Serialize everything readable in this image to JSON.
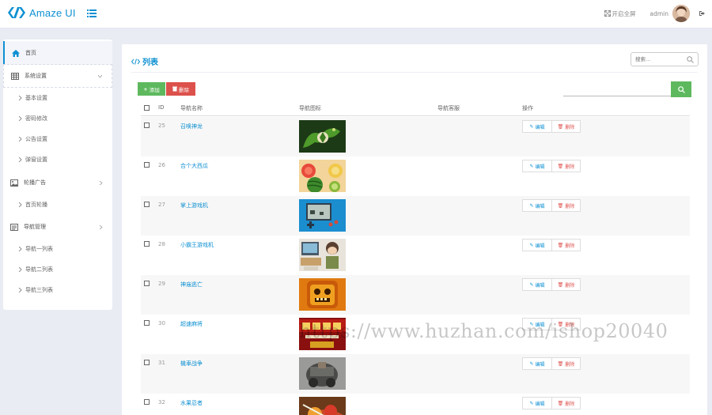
{
  "header": {
    "logo_text": "Amaze UI",
    "fullscreen_label": "开启全屏",
    "admin_name": "admin"
  },
  "sidebar": {
    "home": "首页",
    "groups": [
      {
        "label": "系统设置",
        "items": [
          "基本设置",
          "密码修改",
          "公告设置",
          "弹窗设置"
        ]
      },
      {
        "label": "轮播广告",
        "items": [
          "首页轮播"
        ]
      },
      {
        "label": "导航管理",
        "items": [
          "导航一列表",
          "导航二列表",
          "导航三列表"
        ]
      }
    ]
  },
  "main": {
    "title": "列表",
    "top_search_placeholder": "搜索...",
    "add_label": "添加",
    "delete_label": "删除",
    "columns": {
      "id": "ID",
      "name": "导航名称",
      "icon": "导航图标",
      "service": "导航客服",
      "ops": "操作"
    },
    "edit_label": "编辑",
    "remove_label": "删除",
    "rows": [
      {
        "id": "25",
        "name": "召唤神龙",
        "icon": "dragon-game-thumbnail"
      },
      {
        "id": "26",
        "name": "合个大西瓜",
        "icon": "watermelon-game-thumbnail"
      },
      {
        "id": "27",
        "name": "掌上游戏机",
        "icon": "handheld-console-thumbnail"
      },
      {
        "id": "28",
        "name": "小霸王游戏机",
        "icon": "retro-console-thumbnail"
      },
      {
        "id": "29",
        "name": "神庙逃亡",
        "icon": "temple-run-thumbnail"
      },
      {
        "id": "30",
        "name": "超速麻将",
        "icon": "mahjong-game-thumbnail"
      },
      {
        "id": "31",
        "name": "機車战争",
        "icon": "vehicle-war-thumbnail"
      },
      {
        "id": "32",
        "name": "水果忍者",
        "icon": "fruit-ninja-thumbnail"
      }
    ]
  },
  "watermark": "https://www.huzhan.com/ishop20040",
  "colors": {
    "accent": "#0e90d2",
    "success": "#5eb95e",
    "danger": "#dd514c",
    "background": "#e9ecf3"
  }
}
